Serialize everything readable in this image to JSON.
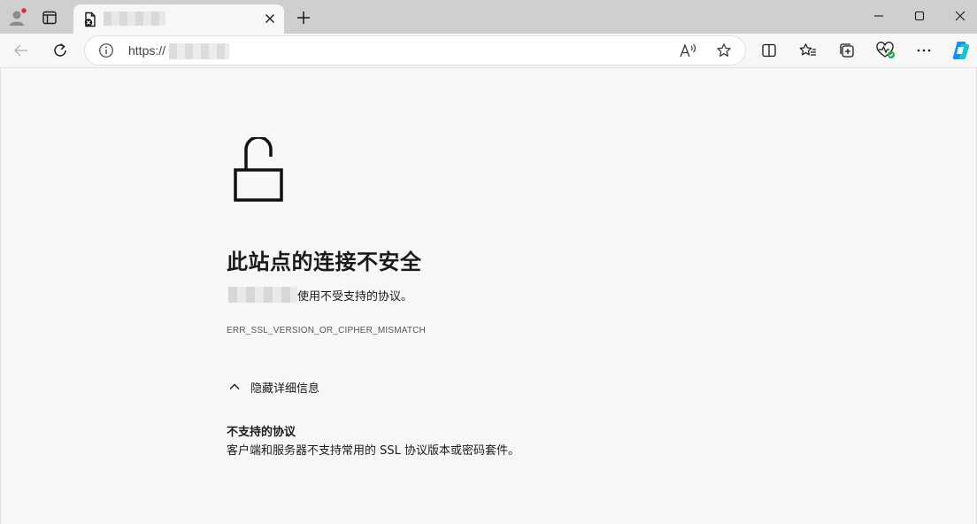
{
  "browser": {
    "address_scheme": "https://",
    "tab_close_label": "×"
  },
  "error_page": {
    "title": "此站点的连接不安全",
    "description": "使用不受支持的协议。",
    "error_code": "ERR_SSL_VERSION_OR_CIPHER_MISMATCH",
    "details_toggle_label": "隐藏详细信息",
    "detail_heading": "不支持的协议",
    "detail_body": "客户端和服务器不支持常用的 SSL 协议版本或密码套件。"
  },
  "icons": {
    "profile": "profile-icon",
    "tab_actions": "tab-actions-icon",
    "favicon": "broken-page-icon",
    "new_tab": "plus-icon",
    "minimize": "minimize-icon",
    "maximize": "maximize-icon",
    "close": "close-icon",
    "back": "back-arrow-icon",
    "refresh": "refresh-icon",
    "info": "info-icon",
    "read_aloud": "read-aloud-icon",
    "add_favorite": "star-icon",
    "split_screen": "split-screen-icon",
    "favorites": "favorites-icon",
    "collections": "collections-icon",
    "browser_essentials": "heart-pulse-icon",
    "more": "more-icon",
    "copilot": "copilot-icon",
    "lock": "unlocked-padlock-icon",
    "chevron": "chevron-up-icon"
  },
  "colors": {
    "page_bg": "#f7f7f7",
    "tabstrip_bg": "#cfcfcf",
    "profile_badge": "#d93025",
    "health_badge": "#2e9e4f"
  }
}
